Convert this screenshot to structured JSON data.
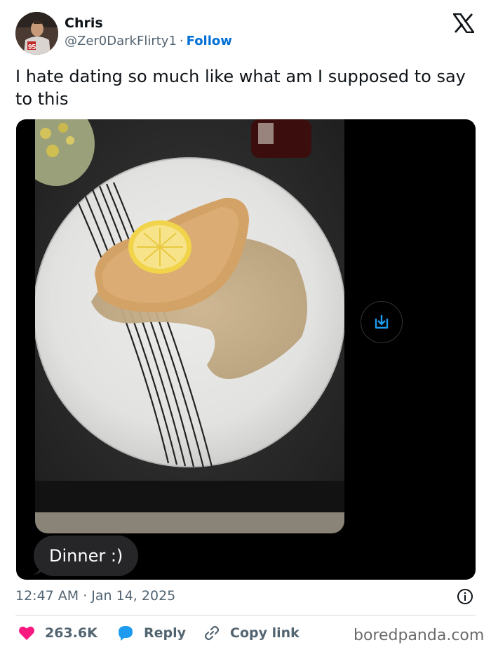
{
  "author": {
    "name": "Chris",
    "handle": "@Zer0DarkFlirty1",
    "separator": "·",
    "follow_label": "Follow"
  },
  "tweet": {
    "text": "I hate dating so much like what am I supposed to say to this",
    "message_bubble": "Dinner :)"
  },
  "meta": {
    "timestamp": "12:47 AM · Jan 14, 2025"
  },
  "actions": {
    "like_count": "263.6K",
    "reply_label": "Reply",
    "copy_label": "Copy link"
  },
  "watermark": "boredpanda.com",
  "icons": {
    "logo": "x-logo-icon",
    "save": "save-icon",
    "info": "info-icon",
    "like": "heart-icon",
    "reply": "reply-icon",
    "copy": "link-icon"
  },
  "colors": {
    "accent": "#006fd6",
    "like": "#f91880",
    "reply": "#1d9bf0",
    "text_secondary": "#536471"
  }
}
